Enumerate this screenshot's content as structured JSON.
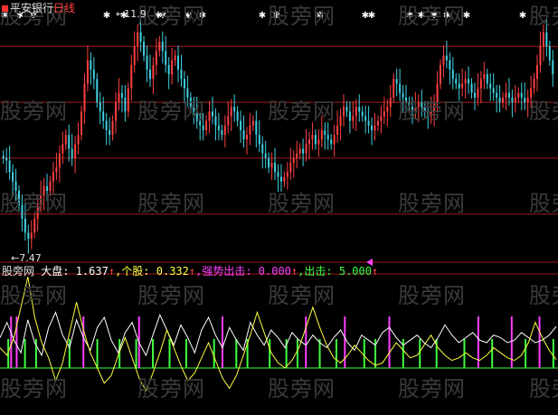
{
  "header": {
    "stock_name": "平安银行",
    "period": "日线",
    "high_label": "←11.9",
    "low_label": "←7.47"
  },
  "watermark_text": "股旁网",
  "indicator_line": {
    "label": "股旁网",
    "items": [
      {
        "name": "大盘:",
        "value": "1.637",
        "color": "#ffffff"
      },
      {
        "name": "个股:",
        "value": "0.332",
        "color": "#ffff40"
      },
      {
        "name": "强势出击:",
        "value": "0.000",
        "color": "#ff40ff"
      },
      {
        "name": "出击:",
        "value": "5.000",
        "color": "#40ff40"
      }
    ],
    "arrow": "↑"
  },
  "colors": {
    "up": "#ff4040",
    "down": "#40d0e0",
    "grid": "#a01818",
    "marker": "#ffffff",
    "line_dapan": "#ffffff",
    "line_gegu": "#ffff40",
    "bars_qiangshi": "#ff40ff",
    "bars_chuji": "#40ff40",
    "baseline": "#40ff40"
  },
  "chart_data": [
    {
      "type": "candlestick",
      "title": "平安银行 日线",
      "ylim": [
        7.2,
        12.4
      ],
      "gridlines": [
        8.0,
        9.2,
        10.4,
        11.6
      ],
      "annotations": [
        "←11.9",
        "←7.47"
      ],
      "series": [
        {
          "name": "平安银行",
          "values": [
            9.2,
            9.15,
            8.9,
            8.7,
            8.5,
            8.2,
            7.9,
            7.6,
            7.47,
            7.6,
            7.9,
            8.2,
            8.4,
            8.6,
            8.5,
            8.7,
            8.9,
            9.0,
            9.3,
            9.5,
            9.7,
            9.4,
            9.2,
            9.5,
            9.7,
            10.2,
            10.8,
            11.3,
            11.1,
            10.9,
            10.4,
            10.2,
            10.0,
            9.8,
            9.7,
            10.0,
            10.4,
            10.6,
            10.5,
            10.2,
            10.7,
            11.2,
            11.6,
            11.9,
            11.7,
            11.4,
            11.1,
            10.9,
            11.2,
            11.5,
            11.7,
            11.5,
            11.2,
            11.0,
            11.3,
            11.4,
            11.1,
            10.9,
            10.7,
            10.5,
            10.3,
            10.2,
            10.0,
            9.9,
            9.8,
            10.0,
            10.2,
            10.1,
            9.9,
            9.8,
            9.7,
            9.9,
            10.1,
            10.3,
            10.2,
            10.0,
            9.8,
            9.6,
            9.7,
            9.9,
            10.0,
            9.7,
            9.5,
            9.3,
            9.2,
            9.0,
            9.1,
            8.9,
            8.8,
            8.7,
            8.8,
            8.9,
            9.1,
            9.2,
            9.3,
            9.4,
            9.3,
            9.5,
            9.6,
            9.7,
            9.5,
            9.6,
            9.8,
            9.7,
            9.6,
            9.5,
            9.7,
            9.9,
            10.1,
            10.3,
            10.2,
            10.0,
            10.1,
            10.3,
            10.2,
            10.1,
            10.0,
            9.9,
            9.8,
            9.9,
            10.0,
            10.1,
            10.2,
            10.3,
            10.5,
            10.9,
            10.8,
            10.6,
            10.5,
            10.4,
            10.3,
            10.2,
            10.3,
            10.4,
            10.3,
            10.2,
            10.1,
            10.2,
            10.4,
            10.8,
            11.2,
            11.4,
            11.3,
            11.1,
            10.9,
            10.8,
            10.7,
            10.8,
            10.9,
            10.8,
            10.6,
            10.5,
            10.7,
            10.9,
            11.0,
            10.8,
            10.7,
            10.6,
            10.5,
            10.4,
            10.5,
            10.6,
            10.5,
            10.4,
            10.5,
            10.6,
            10.5,
            10.4,
            10.5,
            10.7,
            10.9,
            11.2,
            11.6,
            11.9,
            11.6,
            11.3,
            11.0
          ]
        }
      ],
      "top_markers": [
        "✱",
        "✱",
        "✱",
        "✱",
        "✱",
        "✱",
        "✱",
        "✱",
        "✱",
        "✱",
        "✱",
        "✱",
        "✱",
        "✱",
        "✱",
        "✱",
        "✱",
        "✱",
        "✱",
        "✱",
        "✱"
      ]
    },
    {
      "type": "line",
      "title": "股旁网",
      "series": [
        {
          "name": "大盘",
          "values": [
            1.2,
            1.8,
            1.1,
            0.6,
            1.9,
            1.0,
            0.5,
            1.6,
            2.2,
            1.3,
            0.8,
            1.9,
            1.2,
            0.7,
            1.6,
            2.0,
            1.1,
            0.6,
            1.4,
            1.8,
            1.0,
            0.5,
            1.3,
            2.1,
            1.5,
            0.9,
            1.7,
            1.2,
            0.6,
            1.5,
            2.0,
            1.3,
            0.8,
            1.6,
            1.1,
            0.7,
            1.8,
            1.3,
            0.9,
            1.5,
            1.2,
            0.8,
            1.4,
            1.1,
            0.9,
            1.3,
            1.0,
            0.8,
            1.2,
            1.5,
            1.0,
            0.7,
            1.3,
            1.1,
            0.9,
            1.4,
            1.6,
            1.2,
            0.9,
            1.1,
            1.3,
            1.0,
            0.8,
            1.2,
            1.7,
            1.3,
            1.0,
            1.2,
            1.4,
            1.1,
            1.0,
            1.3,
            1.2,
            1.0,
            1.1,
            1.4,
            1.2,
            1.0,
            1.1,
            1.3,
            1.637
          ]
        },
        {
          "name": "个股",
          "values": [
            0.8,
            0.5,
            1.2,
            2.4,
            3.6,
            2.0,
            1.0,
            0.4,
            -0.5,
            0.2,
            1.4,
            2.6,
            1.5,
            0.6,
            0.0,
            -0.6,
            -0.3,
            0.5,
            1.2,
            0.4,
            -0.4,
            -0.9,
            -0.2,
            0.6,
            1.5,
            0.8,
            0.1,
            -0.5,
            -0.2,
            0.4,
            1.0,
            0.3,
            -0.4,
            -0.8,
            -0.3,
            0.5,
            1.3,
            2.2,
            1.4,
            0.6,
            0.2,
            0.0,
            0.3,
            0.8,
            1.6,
            2.4,
            1.6,
            0.9,
            0.4,
            0.2,
            0.5,
            0.9,
            0.6,
            0.3,
            0.1,
            0.2,
            0.6,
            1.0,
            0.7,
            0.4,
            0.5,
            0.9,
            1.3,
            0.8,
            0.5,
            0.3,
            0.4,
            0.6,
            0.4,
            0.3,
            0.5,
            0.8,
            0.6,
            0.4,
            0.3,
            0.5,
            1.0,
            1.8,
            1.2,
            0.7,
            0.332
          ]
        }
      ],
      "bars_qiangshi": [
        2,
        3,
        15,
        25,
        40,
        55,
        62,
        70,
        86,
        92,
        97
      ],
      "bars_chuji": [
        1,
        4,
        6,
        12,
        17,
        21,
        24,
        27,
        30,
        33,
        38,
        42,
        44,
        48,
        51,
        53,
        57,
        60,
        65,
        67,
        72,
        75,
        78,
        83,
        88,
        94,
        99
      ]
    }
  ]
}
